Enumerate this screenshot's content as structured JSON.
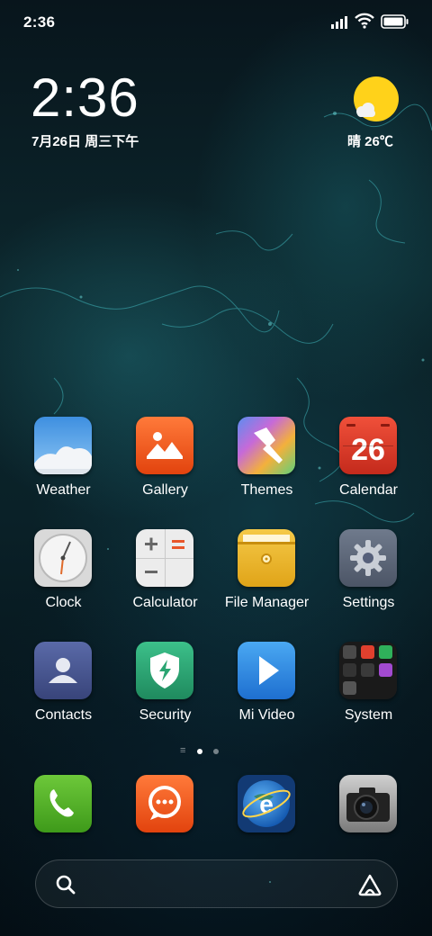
{
  "status_bar": {
    "time": "2:36",
    "signal_icon": "signal-icon",
    "wifi_icon": "wifi-icon",
    "battery_icon": "battery-icon"
  },
  "clock_widget": {
    "time": "2:36",
    "date": "7月26日 周三下午"
  },
  "weather_widget": {
    "icon": "sun-cloud-icon",
    "text": "晴 26℃",
    "sun_color": "#ffd21a"
  },
  "apps": [
    {
      "label": "Weather",
      "icon": "weather-icon"
    },
    {
      "label": "Gallery",
      "icon": "gallery-icon"
    },
    {
      "label": "Themes",
      "icon": "themes-icon"
    },
    {
      "label": "Calendar",
      "icon": "calendar-icon",
      "badge": "26"
    },
    {
      "label": "Clock",
      "icon": "clock-icon"
    },
    {
      "label": "Calculator",
      "icon": "calculator-icon"
    },
    {
      "label": "File Manager",
      "icon": "file-manager-icon"
    },
    {
      "label": "Settings",
      "icon": "gear-icon"
    },
    {
      "label": "Contacts",
      "icon": "contacts-icon"
    },
    {
      "label": "Security",
      "icon": "shield-icon"
    },
    {
      "label": "Mi Video",
      "icon": "play-icon"
    },
    {
      "label": "System",
      "icon": "folder-icon"
    }
  ],
  "page_indicator": {
    "pages": 2,
    "current_page": 1
  },
  "dock": [
    {
      "name": "phone",
      "icon": "phone-icon"
    },
    {
      "name": "messaging",
      "icon": "message-icon"
    },
    {
      "name": "browser",
      "icon": "browser-icon"
    },
    {
      "name": "camera",
      "icon": "camera-icon"
    }
  ],
  "search_bar": {
    "search_icon": "search-icon",
    "assistant_icon": "assistant-icon"
  }
}
